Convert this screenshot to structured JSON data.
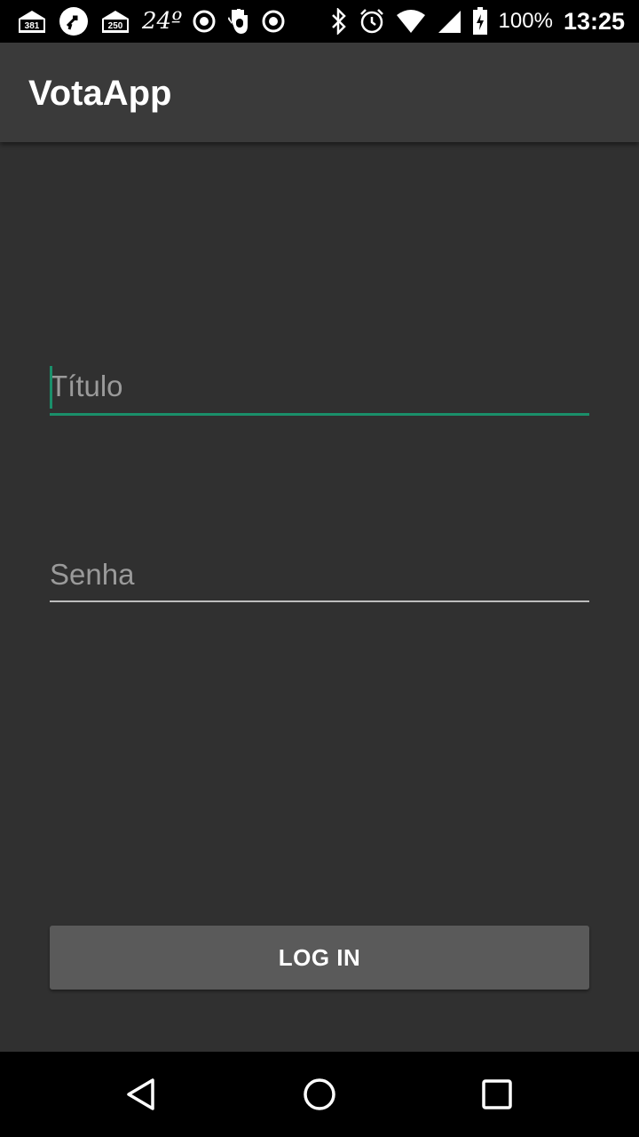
{
  "status_bar": {
    "notification_icons": [
      "mail-381-icon",
      "tap-icon",
      "mail-250-icon",
      "weather-icon",
      "record-icon",
      "hand-icon",
      "record-icon"
    ],
    "badge_381": "381",
    "badge_250": "250",
    "temperature": "24º",
    "system_icons": [
      "bluetooth-icon",
      "alarm-icon",
      "wifi-icon",
      "signal-icon",
      "battery-icon"
    ],
    "battery_percent": "100%",
    "time": "13:25"
  },
  "app_bar": {
    "title": "VotaApp"
  },
  "form": {
    "titulo": {
      "placeholder": "Título",
      "value": "",
      "focused": true
    },
    "senha": {
      "placeholder": "Senha",
      "value": ""
    },
    "login_button_label": "LOG IN"
  },
  "nav_bar": {
    "buttons": [
      "back-icon",
      "home-icon",
      "recents-icon"
    ]
  },
  "colors": {
    "background": "#303030",
    "app_bar": "#3a3a3a",
    "accent": "#1a8f6a",
    "button": "#5a5a5a",
    "system_bars": "#000000"
  }
}
